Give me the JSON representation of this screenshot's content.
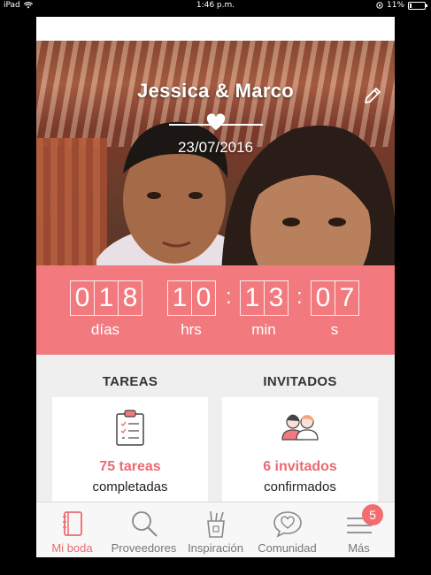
{
  "status_bar": {
    "device": "iPad",
    "time": "1:46 p.m.",
    "battery_percent": "11%",
    "battery_level": 0.11
  },
  "hero": {
    "couple_names": "Jessica & Marco",
    "wedding_date": "23/07/2016",
    "edit_icon": "pencil-icon",
    "divider_icon": "heart-icon"
  },
  "countdown": {
    "days": [
      "0",
      "1",
      "8"
    ],
    "hours": [
      "1",
      "0"
    ],
    "minutes": [
      "1",
      "3"
    ],
    "seconds": [
      "0",
      "7"
    ],
    "labels": {
      "days": "días",
      "hours": "hrs",
      "minutes": "min",
      "seconds": "s"
    }
  },
  "cards": {
    "tasks": {
      "title": "TAREAS",
      "icon": "clipboard-checklist-icon",
      "count_text": "75 tareas",
      "subtitle": "completadas"
    },
    "guests": {
      "title": "INVITADOS",
      "icon": "guests-couple-icon",
      "count_text": "6 invitados",
      "subtitle": "confirmados"
    }
  },
  "tabs": [
    {
      "label": "Mi boda",
      "icon": "notebook-icon",
      "active": true
    },
    {
      "label": "Proveedores",
      "icon": "search-icon",
      "active": false
    },
    {
      "label": "Inspiración",
      "icon": "pencil-cup-icon",
      "active": false
    },
    {
      "label": "Comunidad",
      "icon": "chat-heart-icon",
      "active": false
    },
    {
      "label": "Más",
      "icon": "menu-icon",
      "active": false,
      "badge": "5"
    }
  ],
  "colors": {
    "accent": "#f27a7f",
    "accent_text": "#e96b70",
    "badge": "#f26d6f"
  }
}
